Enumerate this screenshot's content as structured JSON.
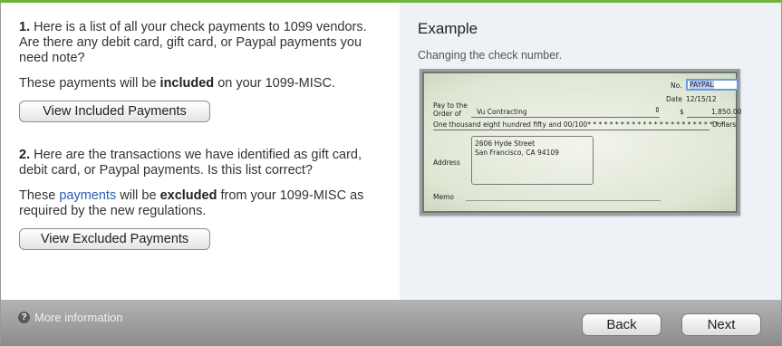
{
  "colors": {
    "accent_top_bar": "#6fb43a",
    "link": "#2a5db0",
    "right_pane_bg": "#eef1f6",
    "footer_bg": "#9e9e9e"
  },
  "step1": {
    "number": "1.",
    "question": "Here is a list of all your check payments to 1099 vendors. Are there any debit card, gift card, or Paypal payments you need note?",
    "note_prefix": "These payments will be",
    "note_bold": "included",
    "note_suffix": "on your 1099-MISC.",
    "button_label": "View Included Payments"
  },
  "step2": {
    "number": "2.",
    "question": "Here are the transactions we have identified as gift card, debit card, or Paypal payments. Is this list correct?",
    "note_prefix": "These",
    "note_link": "payments",
    "note_mid": "will be",
    "note_bold": "excluded",
    "note_suffix": "from your 1099-MISC as required by the new regulations.",
    "button_label": "View Excluded Payments"
  },
  "example": {
    "title": "Example",
    "subtitle": "Changing the check number.",
    "check": {
      "no_label": "No.",
      "no_value": "PAYPAL",
      "date_label": "Date",
      "date_value": "12/15/12",
      "pay_to_label_1": "Pay to the",
      "pay_to_label_2": "Order of",
      "payee": "Vu Contracting",
      "currency": "$",
      "amount": "1,850.00",
      "amount_words": "One thousand eight hundred fifty and 00/100* * * * * * * * * * * * * * * * * * * * * * * * *",
      "dollars_label": "Dollars",
      "address_label": "Address",
      "address_line1": "2606 Hyde Street",
      "address_line2": "San Francisco, CA 94109",
      "memo_label": "Memo"
    }
  },
  "footer": {
    "more_info": "More information",
    "back": "Back",
    "next": "Next"
  }
}
